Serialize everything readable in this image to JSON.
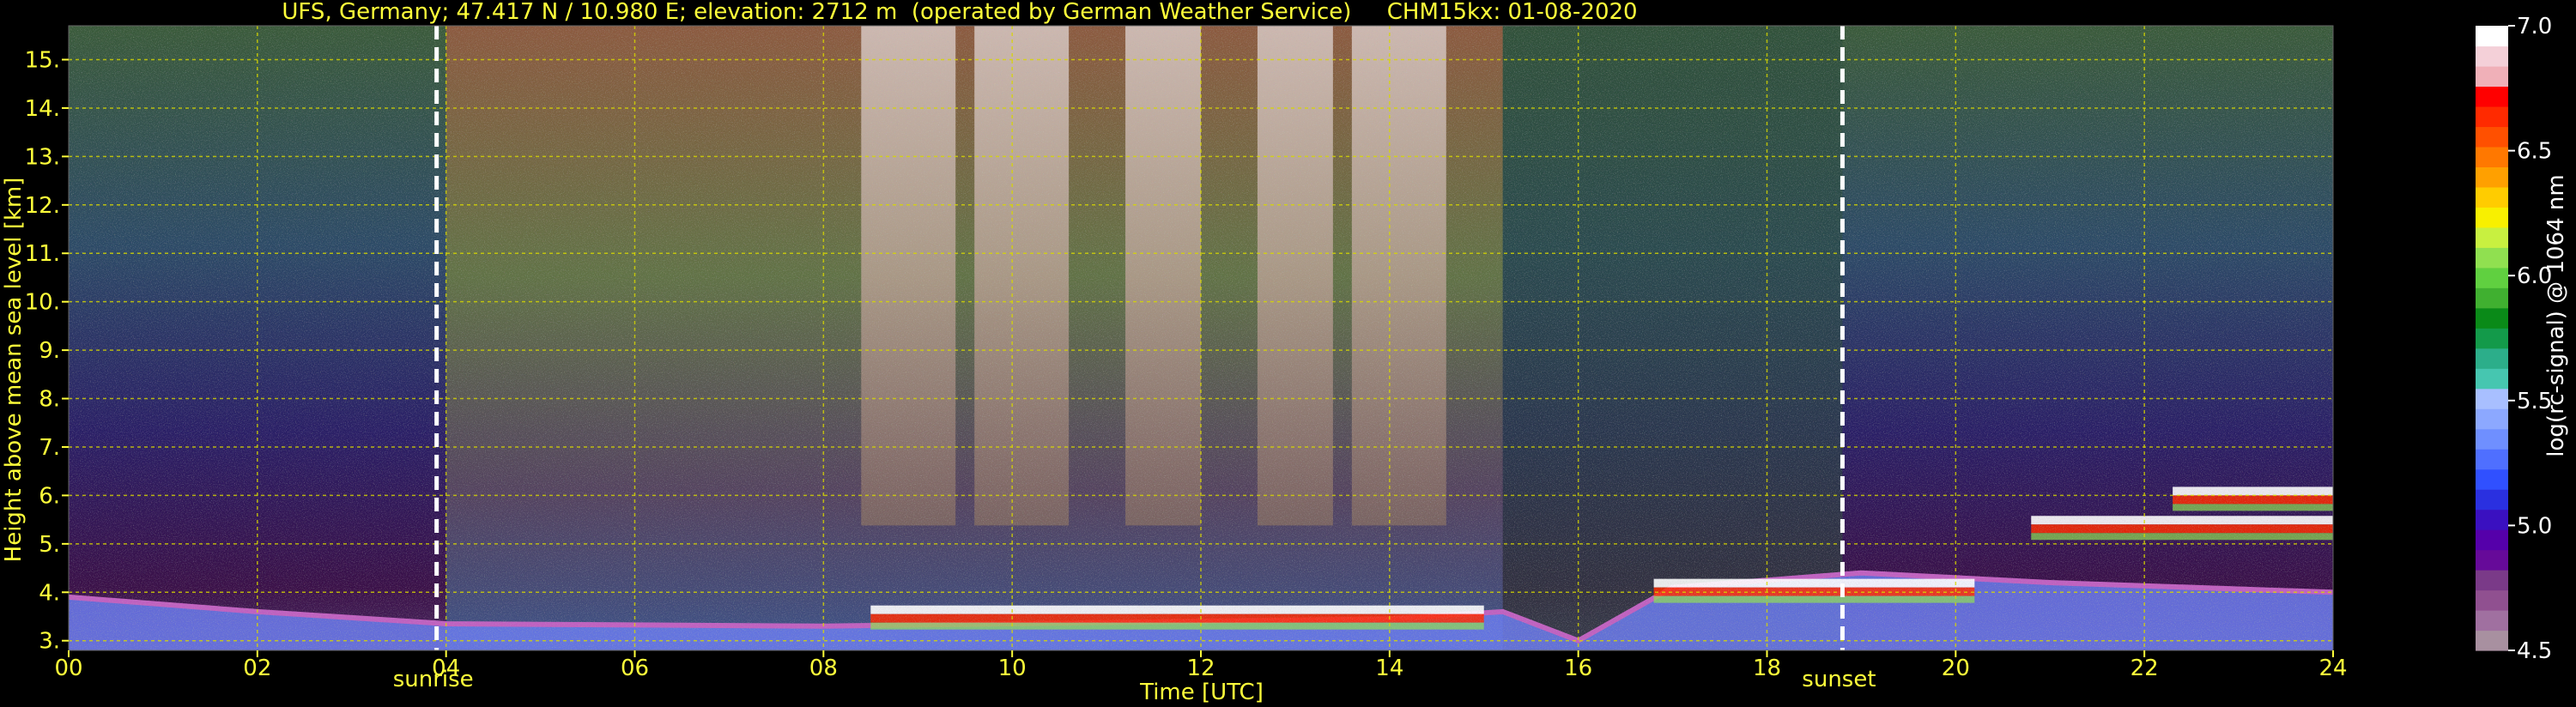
{
  "chart_data": {
    "type": "heatmap",
    "title": "UFS, Germany; 47.417 N / 10.980 E; elevation: 2712 m  (operated by German Weather Service)     CHM15kx: 01-08-2020",
    "xlabel": "Time [UTC]",
    "ylabel": "Height above mean sea level [km]",
    "xlim": [
      0,
      24
    ],
    "ylim": [
      2.8,
      15.7
    ],
    "x_ticks": [
      0,
      2,
      4,
      6,
      8,
      10,
      12,
      14,
      16,
      18,
      20,
      22,
      24
    ],
    "x_tick_labels": [
      "00",
      "02",
      "04",
      "06",
      "08",
      "10",
      "12",
      "14",
      "16",
      "18",
      "20",
      "22",
      "24"
    ],
    "y_ticks": [
      3,
      4,
      5,
      6,
      7,
      8,
      9,
      10,
      11,
      12,
      13,
      14,
      15
    ],
    "y_tick_labels": [
      "3.",
      "4.",
      "5.",
      "6.",
      "7.",
      "8.",
      "9.",
      "10.",
      "11.",
      "12.",
      "13.",
      "14.",
      "15."
    ],
    "grid": true,
    "grid_color": "#d8d800",
    "annotations": [
      {
        "label": "sunrise",
        "x": 3.9
      },
      {
        "label": "sunset",
        "x": 18.8
      }
    ],
    "colorbar": {
      "label": "log(rc-signal) @ 1064 nm",
      "range": [
        4.5,
        7.0
      ],
      "ticks": [
        4.5,
        5.0,
        5.5,
        6.0,
        6.5,
        7.0
      ],
      "tick_labels": [
        "4.5",
        "5.0",
        "5.5",
        "6.0",
        "6.5",
        "7.0"
      ],
      "colors": [
        "#a890a0",
        "#a070a0",
        "#905090",
        "#7a3a88",
        "#660a99",
        "#5500aa",
        "#3a10c0",
        "#2a30e0",
        "#3050ff",
        "#4f6fff",
        "#6f8fff",
        "#8ca8ff",
        "#a8bfff",
        "#46c6b0",
        "#2cae8a",
        "#139a4a",
        "#0a8a18",
        "#40b030",
        "#60d040",
        "#90e050",
        "#c8f040",
        "#f8f000",
        "#ffcc00",
        "#ffa000",
        "#ff7800",
        "#ff5000",
        "#ff2a00",
        "#ff0000",
        "#f0b0b8",
        "#f4d0d8",
        "#ffffff"
      ]
    },
    "cloud_layers": [
      {
        "x_start": 8.5,
        "x_end": 15.0,
        "height": 3.55
      },
      {
        "x_start": 16.8,
        "x_end": 20.2,
        "height": 4.1
      },
      {
        "x_start": 20.8,
        "x_end": 24.0,
        "height": 5.4
      },
      {
        "x_start": 22.3,
        "x_end": 24.0,
        "height": 6.0
      }
    ],
    "surface_layer_top": [
      {
        "x": 0.0,
        "height": 3.9
      },
      {
        "x": 2.0,
        "height": 3.6
      },
      {
        "x": 4.0,
        "height": 3.35
      },
      {
        "x": 8.0,
        "height": 3.3
      },
      {
        "x": 14.0,
        "height": 3.45
      },
      {
        "x": 15.2,
        "height": 3.6
      },
      {
        "x": 16.0,
        "height": 3.0
      },
      {
        "x": 17.0,
        "height": 4.1
      },
      {
        "x": 19.0,
        "height": 4.4
      },
      {
        "x": 21.0,
        "height": 4.2
      },
      {
        "x": 24.0,
        "height": 4.0
      }
    ]
  }
}
